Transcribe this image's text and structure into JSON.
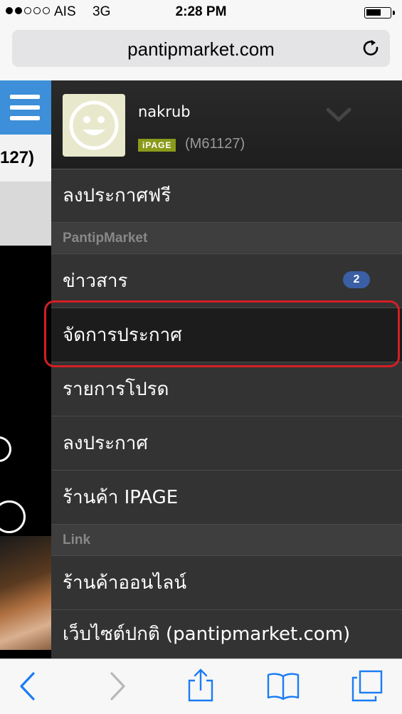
{
  "status_bar": {
    "carrier": "AIS",
    "network": "3G",
    "time": "2:28 PM",
    "signal_bars_filled": 2,
    "signal_bars_total": 5
  },
  "browser": {
    "url": "pantipmarket.com"
  },
  "background_page": {
    "partial_id": "127)"
  },
  "profile": {
    "username": "nakrub",
    "badge": "iPAGE",
    "member_id": "(M61127)"
  },
  "menu": {
    "post_free": "ลงประกาศฟรี",
    "section_pantipmarket": "PantipMarket",
    "news": "ข่าวสาร",
    "news_count": "2",
    "manage_posts": "จัดการประกาศ",
    "favorites": "รายการโปรด",
    "post_ad": "ลงประกาศ",
    "ipage_shop": "ร้านค้า IPAGE",
    "section_link": "Link",
    "online_shop": "ร้านค้าออนไลน์",
    "partial_last": "เว็บไซต์ปกติ (pantipmarket.com)"
  },
  "colors": {
    "drawer_bg": "#333333",
    "active_bg": "#1c1c1c",
    "highlight": "#d31f24",
    "hamburger_bg": "#3c8fd8",
    "badge_bg": "#3a5fa4",
    "ios_blue": "#1a7cf5"
  },
  "icons": {
    "back": "chevron-left-icon",
    "forward": "chevron-right-icon",
    "share": "share-icon",
    "bookmarks": "book-icon",
    "tabs": "tabs-icon",
    "reload": "reload-icon",
    "menu": "hamburger-icon",
    "expand": "chevron-down-icon"
  }
}
